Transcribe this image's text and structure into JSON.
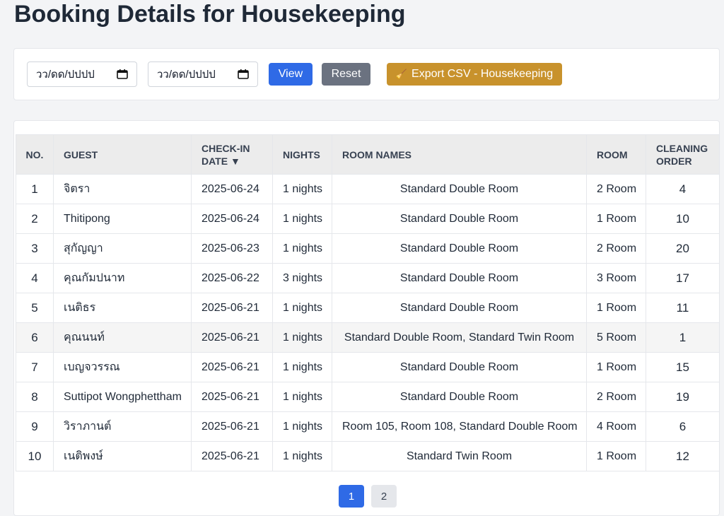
{
  "title": "Booking Details for Housekeeping",
  "filters": {
    "start_date_placeholder": "วว/ดด/ปปปป",
    "end_date_placeholder": "วว/ดด/ปปปป",
    "view_label": "View",
    "reset_label": "Reset",
    "export_icon": "🧹",
    "export_label": "Export CSV - Housekeeping"
  },
  "colors": {
    "view": "#2f6ae6",
    "reset": "#6b7280",
    "export": "#c8922c"
  },
  "table": {
    "headers": {
      "no": "NO.",
      "guest": "GUEST",
      "checkin": "CHECK-IN DATE ▼",
      "nights": "NIGHTS",
      "room_names": "ROOM NAMES",
      "room": "ROOM",
      "cleaning_order": "CLEANING ORDER"
    },
    "rows": [
      {
        "no": "1",
        "guest": "จิตรา",
        "checkin": "2025-06-24",
        "nights": "1 nights",
        "room_names": "Standard Double Room",
        "room": "2 Room",
        "order": "4"
      },
      {
        "no": "2",
        "guest": "Thitipong",
        "checkin": "2025-06-24",
        "nights": "1 nights",
        "room_names": "Standard Double Room",
        "room": "1 Room",
        "order": "10"
      },
      {
        "no": "3",
        "guest": "สุกัญญา",
        "checkin": "2025-06-23",
        "nights": "1 nights",
        "room_names": "Standard Double Room",
        "room": "2 Room",
        "order": "20"
      },
      {
        "no": "4",
        "guest": "คุณกัมปนาท",
        "checkin": "2025-06-22",
        "nights": "3 nights",
        "room_names": "Standard Double Room",
        "room": "3 Room",
        "order": "17"
      },
      {
        "no": "5",
        "guest": "เนติธร",
        "checkin": "2025-06-21",
        "nights": "1 nights",
        "room_names": "Standard Double Room",
        "room": "1 Room",
        "order": "11"
      },
      {
        "no": "6",
        "guest": "คุณนนท์",
        "checkin": "2025-06-21",
        "nights": "1 nights",
        "room_names": "Standard Double Room, Standard Twin Room",
        "room": "5 Room",
        "order": "1"
      },
      {
        "no": "7",
        "guest": "เบญจวรรณ",
        "checkin": "2025-06-21",
        "nights": "1 nights",
        "room_names": "Standard Double Room",
        "room": "1 Room",
        "order": "15"
      },
      {
        "no": "8",
        "guest": "Suttipot Wongphettham",
        "checkin": "2025-06-21",
        "nights": "1 nights",
        "room_names": "Standard Double Room",
        "room": "2 Room",
        "order": "19"
      },
      {
        "no": "9",
        "guest": "วิราภานต์",
        "checkin": "2025-06-21",
        "nights": "1 nights",
        "room_names": "Room 105, Room 108, Standard Double Room",
        "room": "4 Room",
        "order": "6"
      },
      {
        "no": "10",
        "guest": "เนติพงษ์",
        "checkin": "2025-06-21",
        "nights": "1 nights",
        "room_names": "Standard Twin Room",
        "room": "1 Room",
        "order": "12"
      }
    ]
  },
  "pagination": {
    "pages": [
      "1",
      "2"
    ],
    "current": "1"
  }
}
